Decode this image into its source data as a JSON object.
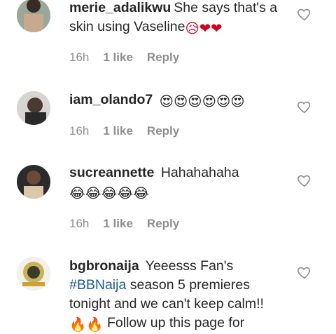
{
  "comments": [
    {
      "username": "merie_adalikwu",
      "text": "She says that's a skin using Vaseline",
      "emojis": "😥❤❤",
      "time": "16h",
      "likes": "1 like",
      "reply": "Reply"
    },
    {
      "username": "iam_olando7",
      "text": "",
      "emojis": "😍😍😍😍😍😍",
      "time": "16h",
      "likes": "1 like",
      "reply": "Reply"
    },
    {
      "username": "sucreannette",
      "text": "Hahahahaha",
      "emojis": "😂😂😂😂😂",
      "time": "16h",
      "likes": "1 like",
      "reply": "Reply"
    },
    {
      "username": "bgbronaija",
      "text_part1": "Yeeesss Fan's",
      "hashtag": "#BBNaija",
      "text_part2": "season 5 premieres tonight and we can't keep calm!!",
      "emojis": "🔥🔥",
      "text_part3": "Follow up this page for"
    }
  ],
  "colors": {
    "username": "#262626",
    "meta": "#8e8e8e",
    "hashtag": "#1d5b8f",
    "heart_outline": "#8e8e8e"
  },
  "icons": [
    "heart-outline-icon"
  ]
}
